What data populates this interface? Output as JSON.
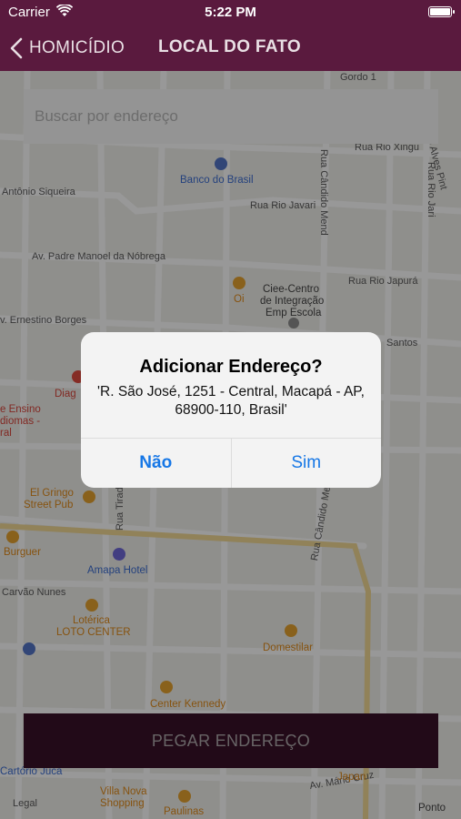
{
  "status_bar": {
    "carrier": "Carrier",
    "time": "5:22 PM"
  },
  "nav": {
    "back_label": "HOMICÍDIO",
    "title": "LOCAL DO FATO"
  },
  "search": {
    "placeholder": "Buscar por endereço"
  },
  "map": {
    "street_labels": {
      "gordo": "Gordo 1",
      "hugo": "R. Hugo Alves Pint",
      "xingu": "Rua Rio Xingu",
      "candido_top": "Rua Cândido Mend",
      "jari": "Rua Rio Jari",
      "javari": "Rua Rio Javari",
      "antonio": "Antônio Siqueira",
      "nobrega": "Av. Padre Manoel da Nóbrega",
      "japura": "Rua Rio Japurá",
      "ernestino": "v. Ernestino Borges",
      "santos": "Santos",
      "carvao": "Carvão Nunes",
      "tiradentes": "Rua Tirad",
      "candido_bottom": "Rua Cândido Me",
      "mario": "Av. Mário Cruz",
      "legal": "Legal"
    },
    "pois": {
      "banco": "Banco do Brasil",
      "oi": "Oi",
      "ciee1": "Ciee-Centro",
      "ciee2": "de Integração",
      "ciee3": "Emp Escola",
      "diag": "Diag",
      "ensino1": "e Ensino",
      "ensino2": "diomas -",
      "ensino3": "ral",
      "gringo1": "El Gringo",
      "gringo2": "Street Pub",
      "burguer": "Burguer",
      "amapa": "Amapa Hotel",
      "loterica1": "Lotérica",
      "loterica2": "LOTO CENTER",
      "domestilar": "Domestilar",
      "kennedy": "Center Kennedy",
      "cartorio": "Cartório Juca",
      "villa1": "Villa Nova",
      "villa2": "Shopping",
      "paulinas": "Paulinas",
      "japan": "Japan",
      "ponto": "Ponto"
    }
  },
  "alert": {
    "title": "Adicionar Endereço?",
    "message": "'R. São José, 1251 - Central, Macapá - AP, 68900-110, Brasil'",
    "cancel_label": "Não",
    "confirm_label": "Sim"
  },
  "bottom_button": {
    "label": "PEGAR ENDEREÇO"
  },
  "colors": {
    "brand": "#5a1a3e",
    "alert_button": "#1677e6"
  }
}
